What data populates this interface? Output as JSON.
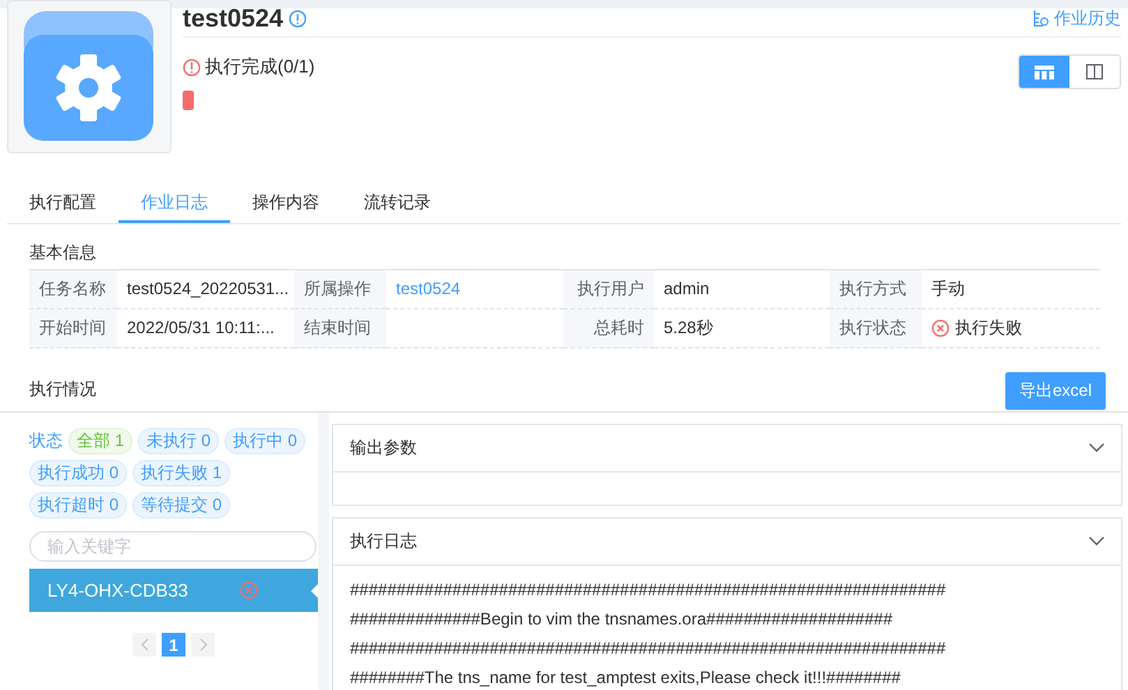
{
  "header": {
    "title": "test0524",
    "history_link": "作业历史",
    "status": "执行完成(0/1)",
    "view_toggle": [
      {
        "kind": "grid",
        "selected": true
      },
      {
        "kind": "columns",
        "selected": false
      }
    ]
  },
  "tabs": [
    {
      "label": "执行配置",
      "selected": false
    },
    {
      "label": "作业日志",
      "selected": true
    },
    {
      "label": "操作内容",
      "selected": false
    },
    {
      "label": "流转记录",
      "selected": false
    }
  ],
  "basic_info": {
    "title": "基本信息",
    "rows": [
      [
        {
          "label": "任务名称",
          "value": "test0524_20220531...",
          "kind": "text"
        },
        {
          "label": "所属操作",
          "value": "test0524",
          "kind": "link"
        },
        {
          "label": "执行用户",
          "value": "admin",
          "kind": "text"
        },
        {
          "label": "执行方式",
          "value": "手动",
          "kind": "text"
        }
      ],
      [
        {
          "label": "开始时间",
          "value": "2022/05/31 10:11:...",
          "kind": "text"
        },
        {
          "label": "结束时间",
          "kind": "text"
        },
        {
          "label": "总耗时",
          "value": "5.28秒",
          "kind": "text"
        },
        {
          "label": "执行状态",
          "value": "执行失败",
          "kind": "failed"
        }
      ]
    ]
  },
  "execution": {
    "title": "执行情况",
    "export_button": "导出excel",
    "filter_label": "状态",
    "filters": [
      {
        "label": "全部 1",
        "selected": true
      },
      {
        "label": "未执行 0",
        "selected": false
      },
      {
        "label": "执行中 0",
        "selected": false
      },
      {
        "label": "执行成功 0",
        "selected": false
      },
      {
        "label": "执行失败 1",
        "selected": false
      },
      {
        "label": "执行超时 0",
        "selected": false
      },
      {
        "label": "等待提交 0",
        "selected": false
      }
    ],
    "search": {
      "placeholder": "输入关键字"
    },
    "tasks": [
      {
        "name": "LY4-OHX-CDB33",
        "failed": true,
        "selected": true
      }
    ],
    "pages": [
      {
        "label": "1",
        "selected": true
      }
    ],
    "panels": [
      {
        "title": "输出参数",
        "expanded": true
      },
      {
        "title": "执行日志",
        "expanded": true,
        "lines": [
          "################################################################",
          "##############Begin to vim the tnsnames.ora####################",
          "################################################################",
          "########The tns_name for test_amptest exits,Please check it!!!########"
        ]
      }
    ]
  }
}
